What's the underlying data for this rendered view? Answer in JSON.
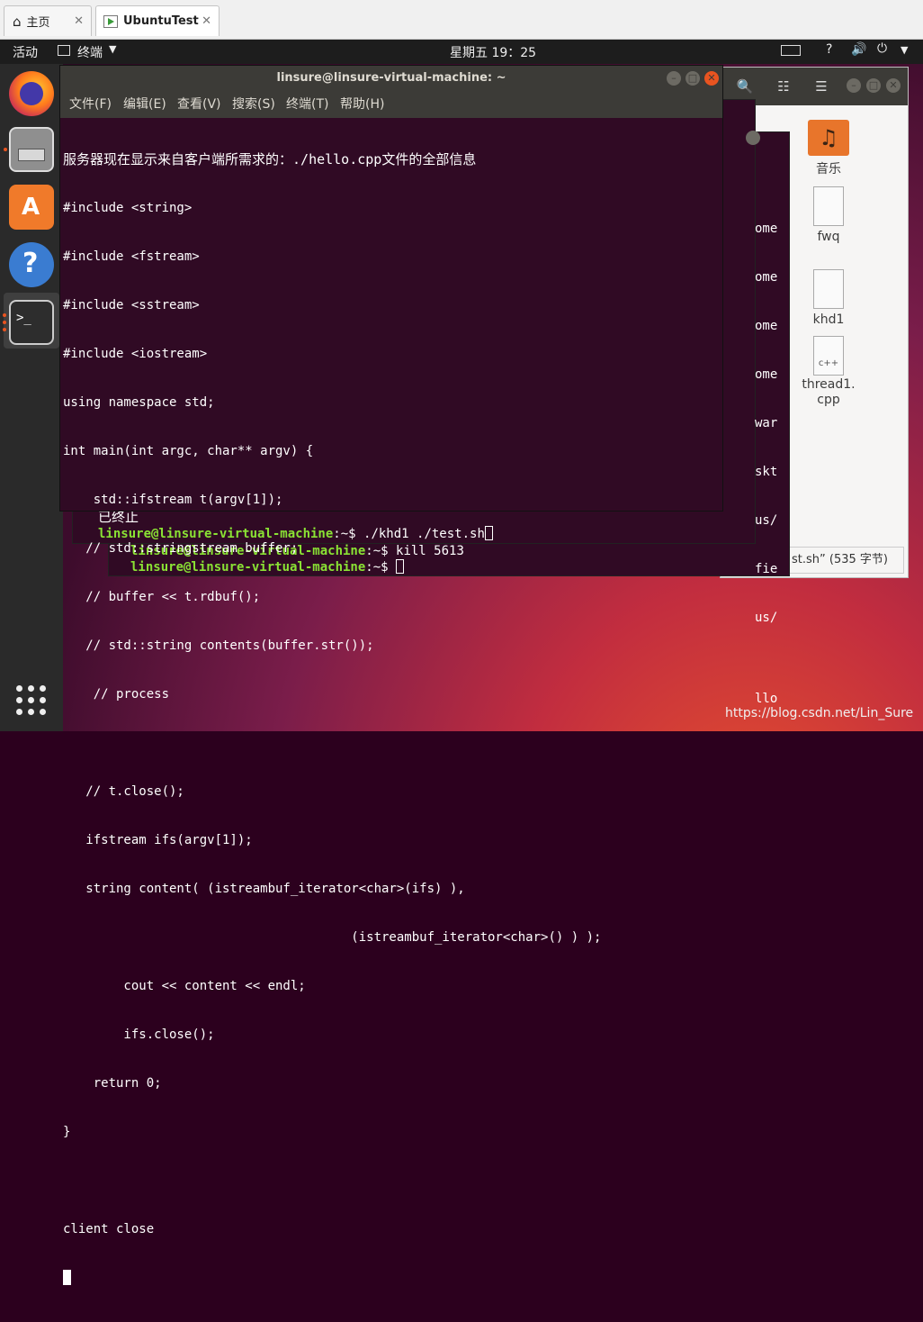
{
  "vm": {
    "tabs": [
      {
        "label": "主页",
        "icon": "home-icon"
      },
      {
        "label": "UbuntuTest",
        "icon": "vm-icon"
      }
    ]
  },
  "topbar": {
    "activities": "活动",
    "app_menu": "终端",
    "clock": "星期五 19：25"
  },
  "terminal": {
    "title": "linsure@linsure-virtual-machine: ~",
    "menu": [
      "文件(F)",
      "编辑(E)",
      "查看(V)",
      "搜索(S)",
      "终端(T)",
      "帮助(H)"
    ],
    "lines": [
      "服务器现在显示来自客户端所需求的：./hello.cpp文件的全部信息",
      "#include <string>",
      "#include <fstream>",
      "#include <sstream>",
      "#include <iostream>",
      "using namespace std;",
      "int main(int argc, char** argv) {",
      "    std::ifstream t(argv[1]);",
      "   // std::stringstream buffer;",
      "   // buffer << t.rdbuf();",
      "   // std::string contents(buffer.str());",
      "    // process",
      "",
      "   // t.close();",
      "   ifstream ifs(argv[1]);",
      "   string content( (istreambuf_iterator<char>(ifs) ),",
      "                                      (istreambuf_iterator<char>() ) );",
      "        cout << content << endl;",
      "        ifs.close();",
      "    return 0;",
      "}",
      "",
      "client close"
    ]
  },
  "mid_terminal": {
    "status": "已终止",
    "prompt_user": "linsure@linsure-virtual-machine",
    "prompt_path": ":~$ ",
    "command": "./khd1 ./test.sh",
    "side_fragments": [
      "ome",
      "ome",
      "ome",
      "ome",
      "war",
      "skt",
      "us/",
      "fie",
      "us/",
      "llo"
    ]
  },
  "back_terminal": {
    "line1_user": "linsure@linsure-virtual-machine",
    "line1_path": ":~$ ",
    "line1_cmd": "kill 5613",
    "line2_user": "linsure@linsure-virtual-machine",
    "line2_path": ":~$ "
  },
  "file_manager": {
    "items": [
      {
        "label": "音乐",
        "icon": "music-folder-icon"
      },
      {
        "label": "fwq",
        "icon": "text-file-icon"
      },
      {
        "label": "khd1",
        "icon": "text-file-icon"
      },
      {
        "label": "thread1.\ncpp",
        "icon": "cpp-file-icon"
      }
    ],
    "status": "st.sh” (535 字节)"
  },
  "watermark": "https://blog.csdn.net/Lin_Sure"
}
